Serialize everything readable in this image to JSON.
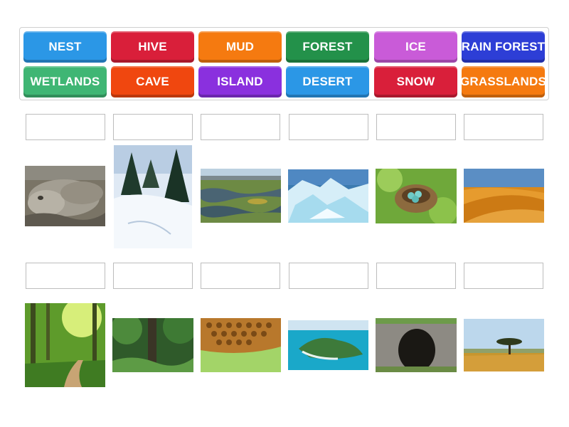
{
  "word_bank": {
    "tiles": [
      {
        "label": "NEST",
        "color": "#2b97e6"
      },
      {
        "label": "HIVE",
        "color": "#d91f3a"
      },
      {
        "label": "MUD",
        "color": "#f57a10"
      },
      {
        "label": "FOREST",
        "color": "#23914a"
      },
      {
        "label": "ICE",
        "color": "#c95bd8"
      },
      {
        "label": "RAIN FOREST",
        "color": "#2d3ed6"
      },
      {
        "label": "WETLANDS",
        "color": "#3fb674"
      },
      {
        "label": "CAVE",
        "color": "#f0470f"
      },
      {
        "label": "ISLAND",
        "color": "#8a30de"
      },
      {
        "label": "DESERT",
        "color": "#2b97e6"
      },
      {
        "label": "SNOW",
        "color": "#d91f3a"
      },
      {
        "label": "GRASSLANDS",
        "color": "#f57a10"
      }
    ]
  },
  "rows": [
    {
      "images": [
        "hippo-in-mud-photo",
        "snowy-forest-photo",
        "wetlands-photo",
        "ice-photo",
        "bird-nest-photo",
        "desert-dunes-photo"
      ]
    },
    {
      "images": [
        "forest-path-photo",
        "rain-forest-photo",
        "honeycomb-hive-photo",
        "tropical-island-photo",
        "cave-entrance-photo",
        "savanna-grassland-photo"
      ]
    }
  ]
}
